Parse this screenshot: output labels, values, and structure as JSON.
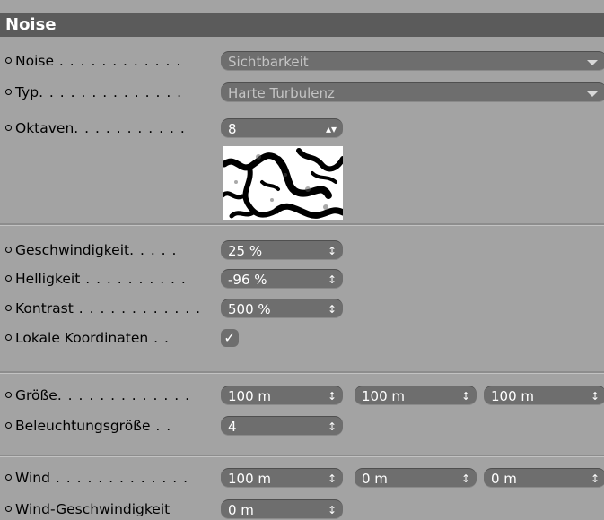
{
  "header": {
    "title": "Noise"
  },
  "rows": {
    "noise": {
      "label": "Noise",
      "dots": " . . . . . . . . . . . .",
      "value": "Sichtbarkeit"
    },
    "typ": {
      "label": "Typ",
      "dots": ". . . . . . . . . . . . . .",
      "value": "Harte Turbulenz"
    },
    "oktaven": {
      "label": "Oktaven",
      "dots": ". . . . . . . . . . .",
      "value": "8"
    },
    "geschwindigkeit": {
      "label": "Geschwindigkeit",
      "dots": ". . . . .",
      "value": "25 %"
    },
    "helligkeit": {
      "label": "Helligkeit",
      "dots": " . . . . . . . . . .",
      "value": "-96 %"
    },
    "kontrast": {
      "label": "Kontrast",
      "dots": " . . . . . . . . . . . .",
      "value": "500 %"
    },
    "lokale": {
      "label": "Lokale Koordinaten",
      "dots": " . .",
      "checked": true
    },
    "groesse": {
      "label": "Größe",
      "dots": ". . . . . . . . . . . . .",
      "values": [
        "100 m",
        "100 m",
        "100 m"
      ]
    },
    "beleuchtung": {
      "label": "Beleuchtungsgröße",
      "dots": " . .",
      "value": "4"
    },
    "wind": {
      "label": "Wind",
      "dots": " . . . . . . . . . . . . .",
      "values": [
        "100 m",
        "0 m",
        "0 m"
      ]
    },
    "windgeschw": {
      "label": "Wind-Geschwindigkeit",
      "dots": "",
      "value": "0 m"
    }
  },
  "icons": {
    "spinner": "up-down-arrows-icon",
    "dropdown": "triangle-down-icon",
    "check": "checkmark-icon"
  },
  "colors": {
    "panel": "#a3a3a3",
    "header": "#5b5b5b",
    "field": "#6e6e6e"
  }
}
